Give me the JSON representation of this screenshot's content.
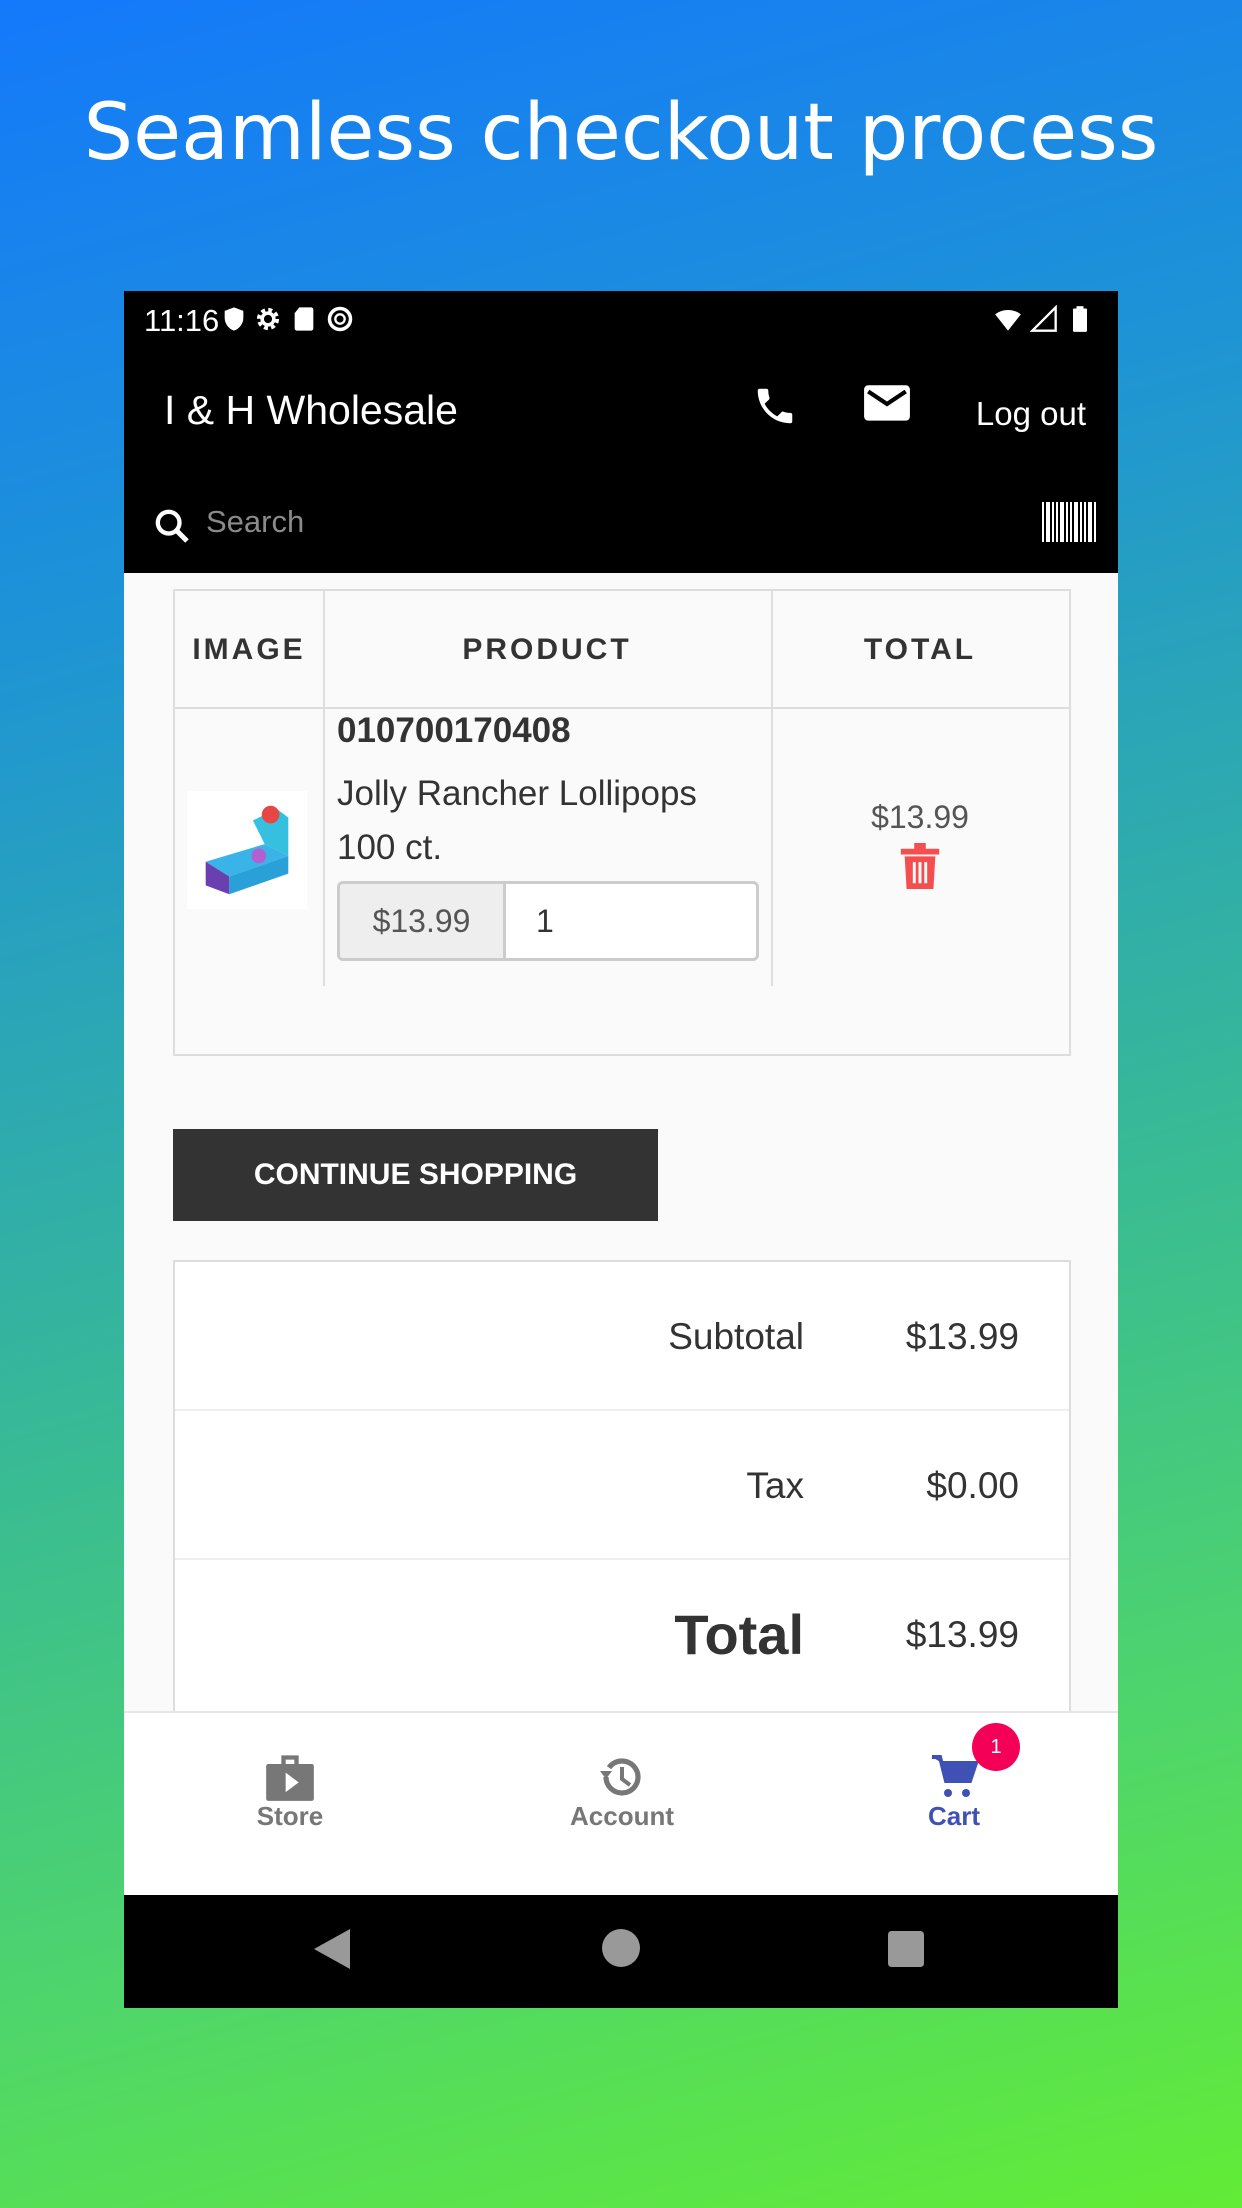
{
  "headline": "Seamless checkout process",
  "status_bar": {
    "time": "11:16",
    "icons": [
      "shield-icon",
      "gear-icon",
      "sd-card-icon",
      "vpn-icon",
      "wifi-icon",
      "signal-icon",
      "battery-icon"
    ]
  },
  "app_bar": {
    "title": "I & H Wholesale",
    "logout_label": "Log out",
    "icons": [
      "phone-icon",
      "mail-icon"
    ]
  },
  "search": {
    "placeholder": "Search"
  },
  "cart_table": {
    "headers": [
      "IMAGE",
      "PRODUCT",
      "TOTAL"
    ],
    "rows": [
      {
        "sku": "010700170408",
        "name": "Jolly Rancher Lollipops 100 ct.",
        "unit_price": "$13.99",
        "quantity": "1",
        "total": "$13.99"
      }
    ]
  },
  "continue_label": "CONTINUE SHOPPING",
  "summary": {
    "subtotal_label": "Subtotal",
    "subtotal": "$13.99",
    "tax_label": "Tax",
    "tax": "$0.00",
    "total_label": "Total",
    "total": "$13.99"
  },
  "bottom_nav": {
    "items": [
      {
        "label": "Store"
      },
      {
        "label": "Account"
      },
      {
        "label": "Cart",
        "badge": "1"
      }
    ],
    "active": "Cart",
    "active_color": "#3f51b5",
    "badge_color": "#f50057"
  },
  "colors": {
    "delete": "#f44e4e"
  }
}
